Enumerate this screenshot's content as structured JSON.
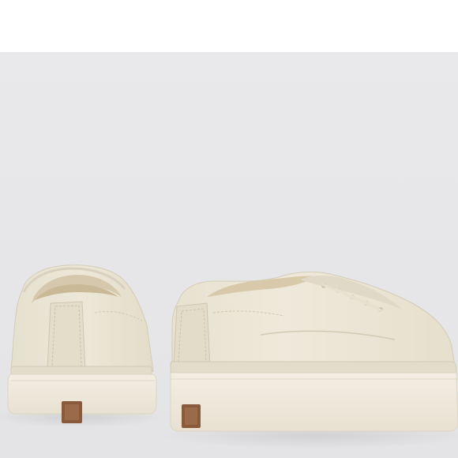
{
  "image": {
    "subject": "pair-of-cream-low-top-sneakers",
    "colors": {
      "backdrop": "#e6e6e8",
      "leather": "#ebe5d6",
      "leather_shade": "#d8d0bd",
      "sole": "#f1ece0",
      "heel_tab": "#8a5a3c",
      "lining": "#d9ccb2"
    }
  }
}
